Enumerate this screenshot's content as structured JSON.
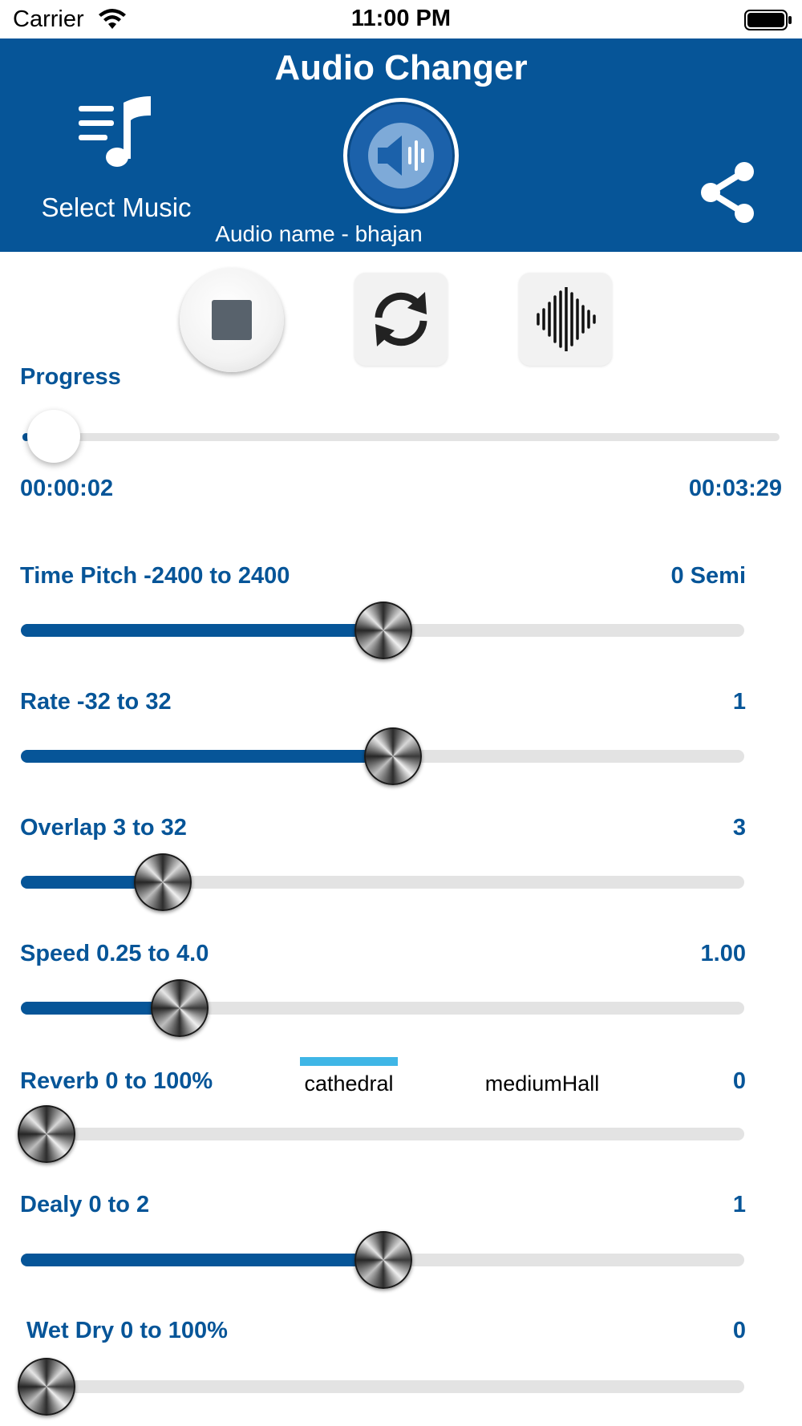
{
  "status_bar": {
    "carrier": "Carrier",
    "time": "11:00 PM"
  },
  "header": {
    "title": "Audio Changer",
    "select_music_label": "Select Music",
    "audio_name": "Audio name - bhajan",
    "icons": [
      "music-list-icon",
      "speaker-icon",
      "share-icon"
    ]
  },
  "controls": {
    "icons": [
      "stop-icon",
      "refresh-icon",
      "waveform-icon"
    ]
  },
  "progress": {
    "label": "Progress",
    "current_time": "00:00:02",
    "total_time": "00:03:29",
    "fraction": 0.01
  },
  "sliders": {
    "time_pitch": {
      "label": "Time Pitch -2400 to 2400",
      "value_text": "0 Semi",
      "fraction": 0.5
    },
    "rate": {
      "label": "Rate -32 to 32",
      "value_text": "1",
      "fraction": 0.515
    },
    "overlap": {
      "label": "Overlap 3 to 32",
      "value_text": "3",
      "fraction": 0.195
    },
    "speed": {
      "label": "Speed 0.25 to 4.0",
      "value_text": "1.00",
      "fraction": 0.22
    },
    "reverb": {
      "label": "Reverb 0 to 100%",
      "value_text": "0",
      "fraction": 0.0,
      "presets": [
        "cathedral",
        "mediumHall"
      ],
      "selected_preset": "cathedral"
    },
    "delay": {
      "label": "Dealy 0 to 2",
      "value_text": "1",
      "fraction": 0.5
    },
    "wet_dry": {
      "label": " Wet Dry 0 to 100%",
      "value_text": "0",
      "fraction": 0.0
    }
  },
  "colors": {
    "brand_blue": "#065598",
    "track_gray": "#e3e3e3",
    "segment_indicator": "#3fb6e6"
  }
}
